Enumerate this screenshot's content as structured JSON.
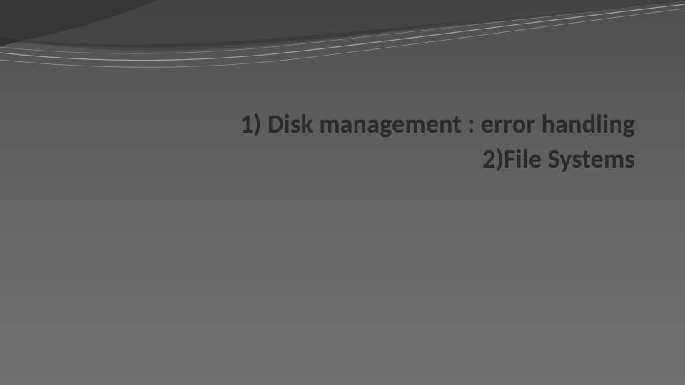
{
  "slide": {
    "title_line1": "1) Disk management : error handling",
    "title_line2": "2)File Systems"
  }
}
